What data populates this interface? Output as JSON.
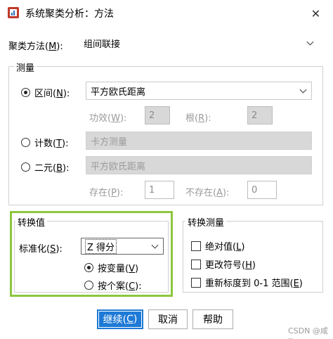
{
  "window": {
    "title": "系统聚类分析：方法",
    "close_glyph": "✕"
  },
  "cluster_method": {
    "label": "聚类方法(M):",
    "label_pre": "聚类方法(",
    "label_key": "M",
    "label_post": "):",
    "value": "组间联接"
  },
  "measure": {
    "legend": "测量",
    "interval": {
      "label_pre": "区间(",
      "label_key": "N",
      "label_post": "):",
      "value": "平方欧氏距离",
      "selected": true
    },
    "power": {
      "label_pre": "功效(",
      "label_key": "W",
      "label_post": "):",
      "value": "2"
    },
    "root": {
      "label_pre": "根(",
      "label_key": "R",
      "label_post": "):",
      "value": "2"
    },
    "counts": {
      "label_pre": "计数(",
      "label_key": "T",
      "label_post": "):",
      "value": "卡方测量",
      "selected": false
    },
    "binary": {
      "label_pre": "二元(",
      "label_key": "B",
      "label_post": "):",
      "value": "平方欧氏距离",
      "selected": false
    },
    "present": {
      "label_pre": "存在(",
      "label_key": "P",
      "label_post": "):",
      "value": "1"
    },
    "absent": {
      "label_pre": "不存在(",
      "label_key": "A",
      "label_post": "):",
      "value": "0"
    }
  },
  "transform_values": {
    "legend": "转换值",
    "standardize": {
      "label_pre": "标准化(",
      "label_key": "S",
      "label_post": "):",
      "value": "Z 得分"
    },
    "by_variable": {
      "label_pre": "按变量(",
      "label_key": "V",
      "label_post": ")",
      "selected": true
    },
    "by_case": {
      "label_pre": "按个案(",
      "label_key": "C",
      "label_post": "):",
      "selected": false
    },
    "highlight_color": "#8dc63f"
  },
  "transform_measures": {
    "legend": "转换测量",
    "absolute": {
      "label_pre": "绝对值(",
      "label_key": "L",
      "label_post": ")",
      "checked": false
    },
    "change_sign": {
      "label_pre": "更改符号(",
      "label_key": "H",
      "label_post": ")",
      "checked": false
    },
    "rescale": {
      "label_pre": "重新标度到 0-1 范围(",
      "label_key": "E",
      "label_post": ")",
      "checked": false
    }
  },
  "buttons": {
    "continue": {
      "label_pre": "继续(",
      "label_key": "C",
      "label_post": ")"
    },
    "cancel": "取消",
    "help": "帮助"
  },
  "colors": {
    "primary": "#1e7ad6",
    "disabled_bg": "#d8d8d8",
    "highlight": "#8dc63f"
  },
  "watermark": "CSDN @咸狗"
}
